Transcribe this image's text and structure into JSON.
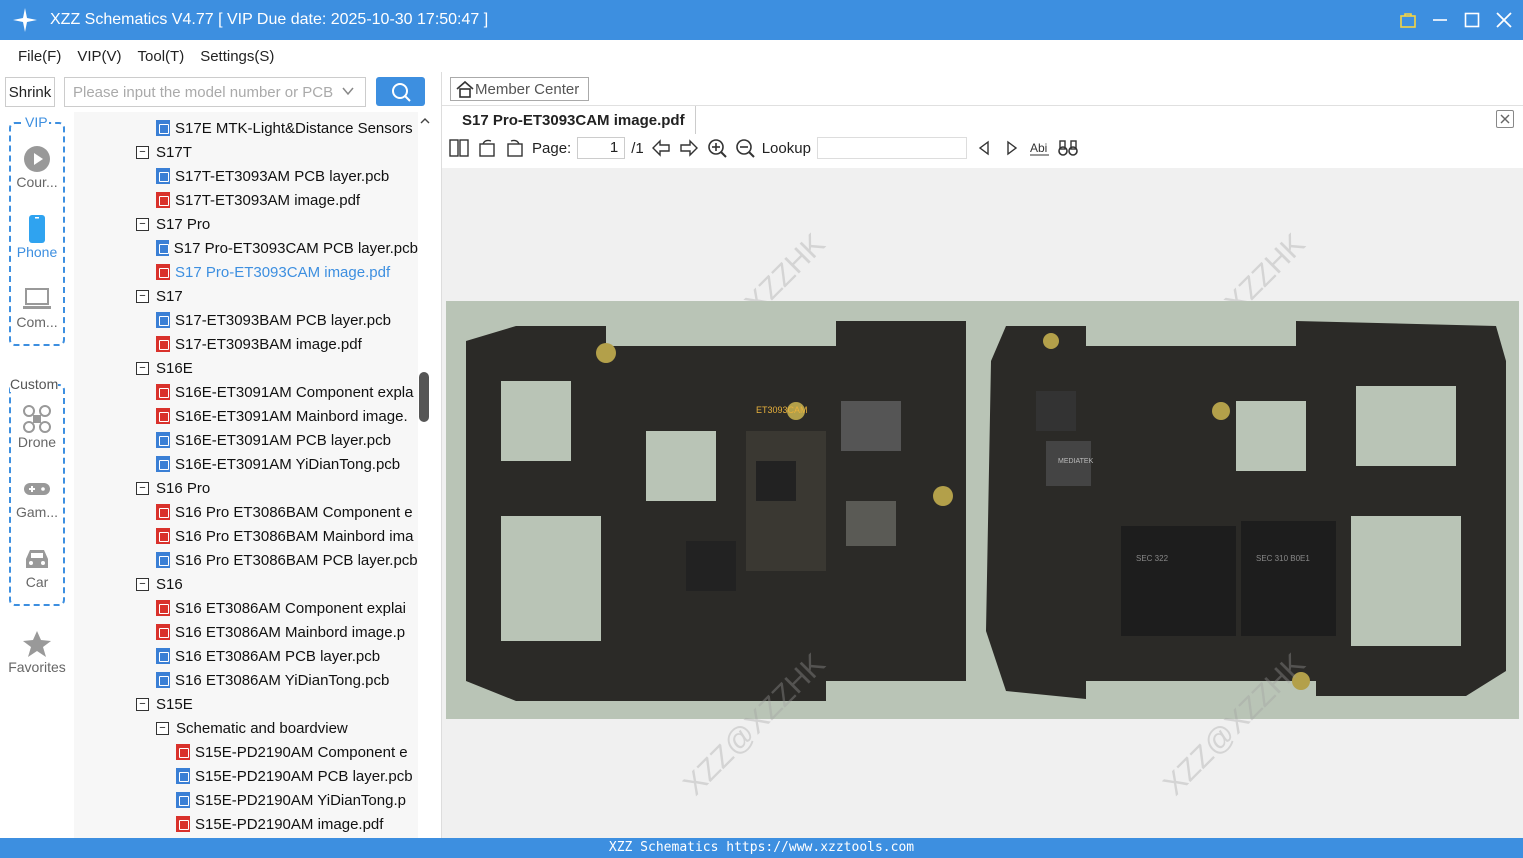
{
  "window": {
    "title": "XZZ Schematics V4.77 [ VIP Due date: 2025-10-30 17:50:47 ]"
  },
  "menu": [
    {
      "label": "File(F)"
    },
    {
      "label": "VIP(V)"
    },
    {
      "label": "Tool(T)"
    },
    {
      "label": "Settings(S)"
    }
  ],
  "search": {
    "shrink_label": "Shrink",
    "placeholder": "Please input the model number or PCB"
  },
  "sidebar": {
    "vip_label": "VIP",
    "custom_label": "Custom",
    "items": [
      {
        "label": "Cour..."
      },
      {
        "label": "Phone"
      },
      {
        "label": "Com..."
      },
      {
        "label": "Drone"
      },
      {
        "label": "Gam..."
      },
      {
        "label": "Car"
      },
      {
        "label": "Favorites"
      }
    ]
  },
  "tree": [
    {
      "level": 1,
      "type": "pcb",
      "label": "S17E MTK-Light&Distance Sensors"
    },
    {
      "level": 0,
      "type": "folder",
      "label": "S17T"
    },
    {
      "level": 1,
      "type": "pcb",
      "label": "S17T-ET3093AM PCB layer.pcb"
    },
    {
      "level": 1,
      "type": "pdf",
      "label": "S17T-ET3093AM image.pdf"
    },
    {
      "level": 0,
      "type": "folder",
      "label": "S17 Pro"
    },
    {
      "level": 1,
      "type": "pcb",
      "label": "S17 Pro-ET3093CAM PCB layer.pcb"
    },
    {
      "level": 1,
      "type": "pdf",
      "label": "S17 Pro-ET3093CAM image.pdf",
      "selected": true
    },
    {
      "level": 0,
      "type": "folder",
      "label": "S17"
    },
    {
      "level": 1,
      "type": "pcb",
      "label": "S17-ET3093BAM PCB layer.pcb"
    },
    {
      "level": 1,
      "type": "pdf",
      "label": "S17-ET3093BAM image.pdf"
    },
    {
      "level": 0,
      "type": "folder",
      "label": "S16E"
    },
    {
      "level": 1,
      "type": "pdf",
      "label": "S16E-ET3091AM Component expla"
    },
    {
      "level": 1,
      "type": "pdf",
      "label": "S16E-ET3091AM Mainbord image."
    },
    {
      "level": 1,
      "type": "pcb",
      "label": "S16E-ET3091AM PCB layer.pcb"
    },
    {
      "level": 1,
      "type": "pcb",
      "label": "S16E-ET3091AM YiDianTong.pcb"
    },
    {
      "level": 0,
      "type": "folder",
      "label": "S16 Pro"
    },
    {
      "level": 1,
      "type": "pdf",
      "label": "S16 Pro ET3086BAM Component e"
    },
    {
      "level": 1,
      "type": "pdf",
      "label": "S16 Pro ET3086BAM Mainbord ima"
    },
    {
      "level": 1,
      "type": "pcb",
      "label": "S16 Pro ET3086BAM PCB layer.pcb"
    },
    {
      "level": 0,
      "type": "folder",
      "label": "S16"
    },
    {
      "level": 1,
      "type": "pdf",
      "label": "S16 ET3086AM Component explai"
    },
    {
      "level": 1,
      "type": "pdf",
      "label": "S16 ET3086AM Mainbord image.p"
    },
    {
      "level": 1,
      "type": "pcb",
      "label": "S16 ET3086AM PCB layer.pcb"
    },
    {
      "level": 1,
      "type": "pcb",
      "label": "S16 ET3086AM YiDianTong.pcb"
    },
    {
      "level": 0,
      "type": "folder",
      "label": "S15E"
    },
    {
      "level": 1,
      "type": "folder",
      "label": "Schematic and boardview"
    },
    {
      "level": 2,
      "type": "pdf",
      "label": "S15E-PD2190AM Component e"
    },
    {
      "level": 2,
      "type": "pcb",
      "label": "S15E-PD2190AM PCB layer.pcb"
    },
    {
      "level": 2,
      "type": "pcb",
      "label": "S15E-PD2190AM YiDianTong.p"
    },
    {
      "level": 2,
      "type": "pdf",
      "label": "S15E-PD2190AM image.pdf"
    }
  ],
  "viewer": {
    "member_center": "Member Center",
    "tab_label": "S17 Pro-ET3093CAM image.pdf",
    "page_label": "Page:",
    "page_current": "1",
    "page_total": "/1",
    "lookup_label": "Lookup",
    "watermark": "XZZ@XZZHK",
    "board_texts": [
      "ET3093CAM",
      "MEDIATEK",
      "SEC 322",
      "SEC 310 B0E1"
    ]
  },
  "status": {
    "text": "XZZ Schematics https://www.xzztools.com"
  },
  "colors": {
    "accent": "#3d8fe0",
    "pdf_icon": "#d9312b",
    "pcb_icon": "#3a7fd5",
    "board_bg": "#b9c4b6",
    "pcb": "#2b2a27"
  }
}
